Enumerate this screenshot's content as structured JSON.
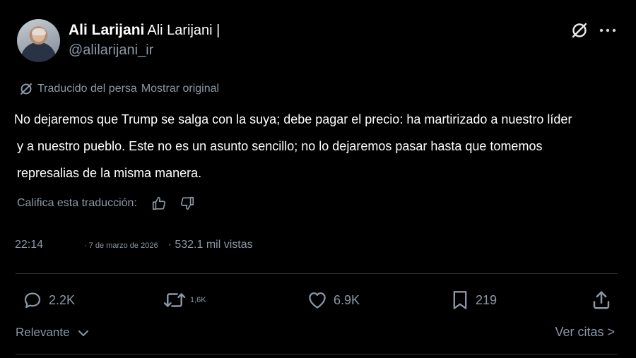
{
  "author": {
    "name": "Ali Larijani",
    "name_secondary": "Ali Larijani |",
    "handle": "@alilarijani_ir"
  },
  "translation": {
    "notice": "Traducido del persa",
    "show_original": "Mostrar original"
  },
  "post": {
    "lines": [
      "No dejaremos que Trump se salga con la suya; debe pagar el precio: ha martirizado a nuestro líder",
      "y a nuestro pueblo. Este no es un asunto sencillo; no lo dejaremos pasar hasta que tomemos",
      "represalias de la misma manera."
    ]
  },
  "rating": {
    "label": "Califica esta traducción:"
  },
  "meta": {
    "time": "22:14",
    "date": "· 7 de marzo de 2026",
    "views": "· 532.1 mil vistas"
  },
  "actions": {
    "replies": "2.2K",
    "reposts": "1,6K",
    "likes": "6.9K",
    "bookmarks": "219"
  },
  "footer": {
    "sort_label": "Relevante",
    "quotes_link": "Ver citas >"
  },
  "colors": {
    "background": "#000000",
    "text": "#ffffff",
    "muted": "#8b98a5",
    "divider": "#2f3336"
  }
}
